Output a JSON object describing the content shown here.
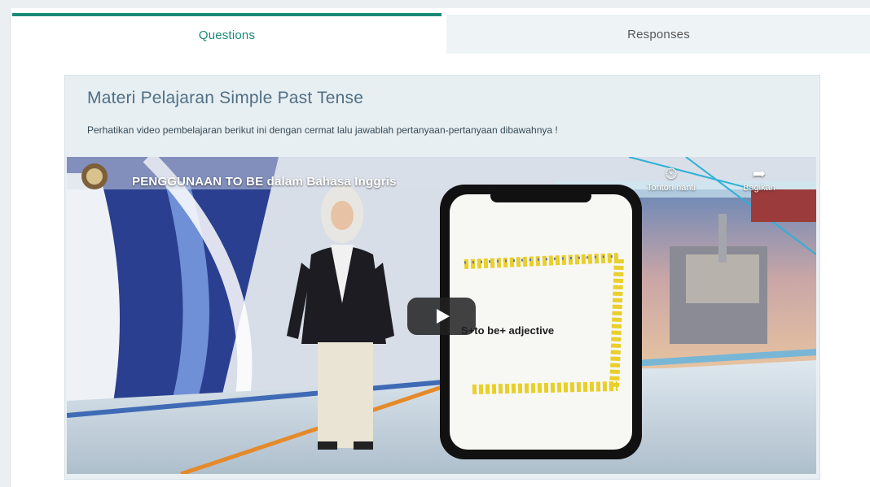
{
  "tabs": {
    "questions": "Questions",
    "responses": "Responses"
  },
  "card": {
    "title": "Materi Pelajaran Simple Past Tense",
    "description": "Perhatikan video pembelajaran berikut ini dengan cermat lalu jawablah pertanyaan-pertanyaan dibawahnya !"
  },
  "video": {
    "title": "PENGGUNAAN TO BE dalam Bahasa Inggris",
    "watch_later_label": "Tonton nanti",
    "share_label": "Bagikan",
    "phone_text": "S+to be+ adjective",
    "icons": {
      "watch_later": "clock-icon",
      "share": "share-icon",
      "play": "play-icon"
    }
  },
  "colors": {
    "accent": "#1a8a78",
    "card_bg": "#e8eff2",
    "title_color": "#4f6f86"
  }
}
